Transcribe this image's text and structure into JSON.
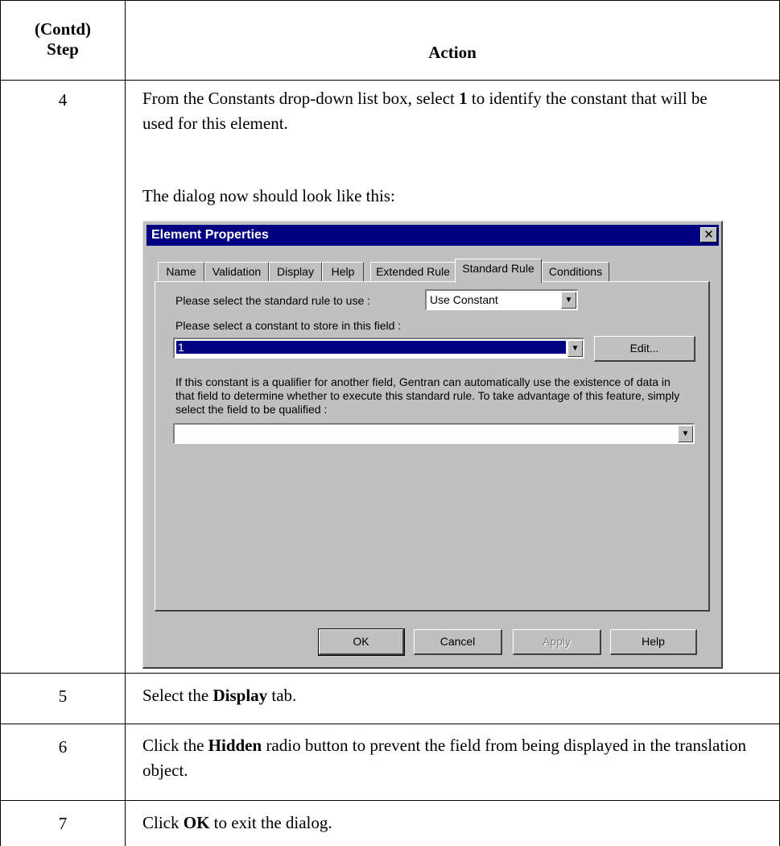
{
  "table": {
    "header_step": "(Contd)\nStep",
    "header_step_line1": "(Contd)",
    "header_step_line2": "Step",
    "header_action": "Action"
  },
  "rows": [
    {
      "step": "4",
      "text_a": "From the Constants drop-down list box, select ",
      "bold_a": "1",
      "text_b": " to identify the constant that will be used for this element.",
      "text_c": "The dialog now should look like this:"
    },
    {
      "step": "5",
      "text_a": "Select the ",
      "bold_a": "Display",
      "text_b": " tab."
    },
    {
      "step": "6",
      "text_a": "Click the ",
      "bold_a": "Hidden",
      "text_b": " radio button to prevent the field from being displayed in the translation object."
    },
    {
      "step": "7",
      "text_a": "Click ",
      "bold_a": "OK",
      "text_b": " to exit the dialog."
    }
  ],
  "dialog": {
    "title": "Element Properties",
    "close_glyph": "✕",
    "tabs": [
      "Name",
      "Validation",
      "Display",
      "Help",
      "Extended Rule",
      "Standard Rule",
      "Conditions"
    ],
    "active_tab": "Standard Rule",
    "rule_label": "Please select the standard rule to use :",
    "rule_value": "Use Constant",
    "constant_label": "Please select a constant to store in this field :",
    "constant_value": "1",
    "edit_button": "Edit...",
    "qualifier_text": "If this constant is a qualifier for another field, Gentran can automatically use the existence of data in that field to determine whether to execute this standard rule. To take advantage of this feature, simply select the field to be qualified :",
    "qualifier_value": "",
    "buttons": {
      "ok": "OK",
      "cancel": "Cancel",
      "apply": "Apply",
      "help": "Help"
    },
    "dropdown_glyph": "▼"
  }
}
